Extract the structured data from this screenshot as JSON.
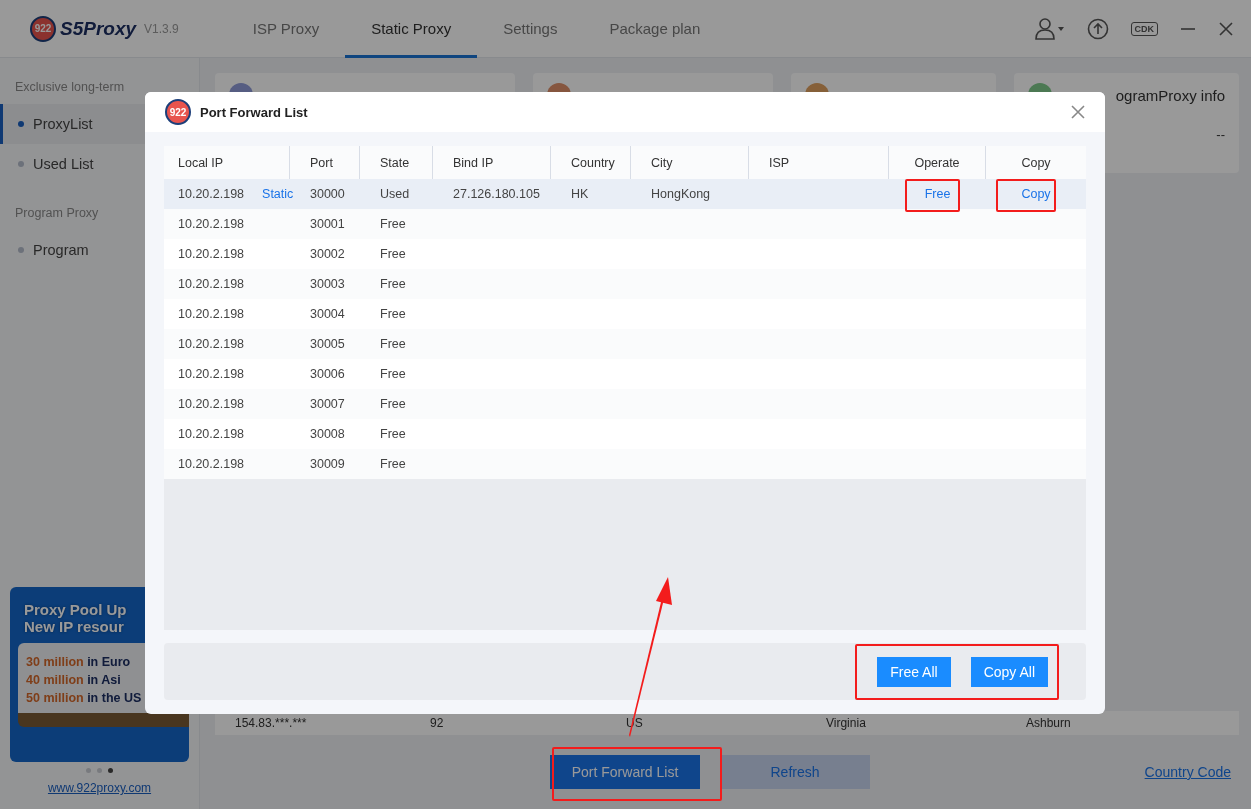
{
  "header": {
    "logo_badge": "922",
    "logo": "S5Proxy",
    "version": "V1.3.9",
    "cdk": "CDK"
  },
  "tabs": [
    {
      "label": "ISP Proxy",
      "selected": false
    },
    {
      "label": "Static Proxy",
      "selected": true
    },
    {
      "label": "Settings",
      "selected": false
    },
    {
      "label": "Package plan",
      "selected": false
    }
  ],
  "sidebar": {
    "sections": [
      {
        "title": "Exclusive long-term",
        "items": [
          {
            "label": "ProxyList",
            "selected": true
          },
          {
            "label": "Used List",
            "selected": false
          }
        ]
      },
      {
        "title": "Program Proxy",
        "items": [
          {
            "label": "Program",
            "selected": false
          }
        ]
      }
    ],
    "banner": {
      "headline": [
        "Proxy Pool Up",
        "New IP resour"
      ],
      "lines": [
        {
          "amount": "30 million",
          "rest": "in Euro"
        },
        {
          "amount": "40 million",
          "rest": "in Asi"
        },
        {
          "amount": "50 million",
          "rest": "in the US"
        }
      ]
    },
    "dots": [
      {
        "selected": false
      },
      {
        "selected": false
      },
      {
        "selected": true
      }
    ],
    "link": "www.922proxy.com"
  },
  "cards": [
    {
      "color": "#565d82"
    },
    {
      "color": "#86563f"
    },
    {
      "color": "#866039"
    },
    {
      "color": "#4c7953",
      "title": "ogramProxy info",
      "value": "--"
    }
  ],
  "background_row": [
    "154.83.***.***",
    "92",
    "US",
    "Virginia",
    "Ashburn"
  ],
  "bottom": {
    "primary_button": "Port Forward List",
    "refresh_button": "Refresh",
    "link": "Country Code"
  },
  "dialog": {
    "badge": "922",
    "title": "Port Forward List",
    "columns": [
      "Local IP",
      "Port",
      "State",
      "Bind IP",
      "Country",
      "City",
      "ISP",
      "Operate",
      "Copy"
    ],
    "rows": [
      {
        "local_ip": "10.20.2.198",
        "tag": "Static",
        "port": "30000",
        "state": "Used",
        "bind_ip": "27.126.180.105",
        "country": "HK",
        "city": "HongKong",
        "operate": "Free",
        "copy": "Copy",
        "selected": true
      },
      {
        "local_ip": "10.20.2.198",
        "port": "30001",
        "state": "Free",
        "selected": false
      },
      {
        "local_ip": "10.20.2.198",
        "port": "30002",
        "state": "Free",
        "selected": false
      },
      {
        "local_ip": "10.20.2.198",
        "port": "30003",
        "state": "Free",
        "selected": false
      },
      {
        "local_ip": "10.20.2.198",
        "port": "30004",
        "state": "Free",
        "selected": false
      },
      {
        "local_ip": "10.20.2.198",
        "port": "30005",
        "state": "Free",
        "selected": false
      },
      {
        "local_ip": "10.20.2.198",
        "port": "30006",
        "state": "Free",
        "selected": false
      },
      {
        "local_ip": "10.20.2.198",
        "port": "30007",
        "state": "Free",
        "selected": false
      },
      {
        "local_ip": "10.20.2.198",
        "port": "30008",
        "state": "Free",
        "selected": false
      },
      {
        "local_ip": "10.20.2.198",
        "port": "30009",
        "state": "Free",
        "selected": false
      }
    ],
    "buttons": [
      "Free All",
      "Copy All"
    ]
  }
}
